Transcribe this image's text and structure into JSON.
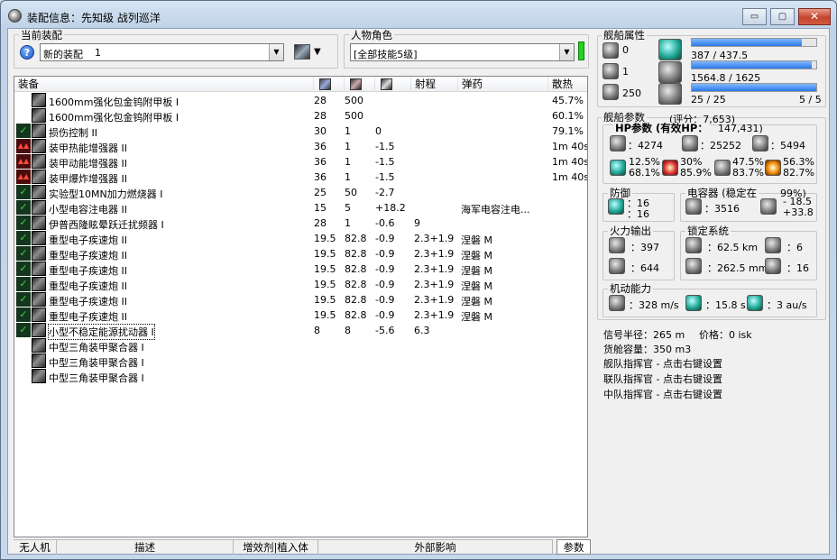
{
  "window": {
    "title": "装配信息：先知级 战列巡洋",
    "controls": {
      "minimize": "▭",
      "maximize": "▢",
      "close": "✕"
    }
  },
  "fitting": {
    "current_label": "当前装配",
    "fit_name": "新的装配",
    "fit_count": "1"
  },
  "character": {
    "label": "人物角色",
    "value": "[全部技能5级]"
  },
  "columns": {
    "equipment": "装备",
    "range": "射程",
    "ammo": "弹药",
    "dispersion": "散热",
    "icon_names": [
      "capacitor-icon",
      "cpu-icon",
      "powergrid-icon"
    ]
  },
  "modules": [
    {
      "status": "none",
      "name": "1600mm强化包金钨附甲板 I",
      "cpu": "28",
      "pg": "500",
      "cap": "",
      "range": "",
      "ammo": "",
      "heat": "45.7%"
    },
    {
      "status": "none",
      "name": "1600mm强化包金钨附甲板 I",
      "cpu": "28",
      "pg": "500",
      "cap": "",
      "range": "",
      "ammo": "",
      "heat": "60.1%"
    },
    {
      "status": "on",
      "name": "损伤控制 II",
      "cpu": "30",
      "pg": "1",
      "cap": "0",
      "range": "",
      "ammo": "",
      "heat": "79.1%"
    },
    {
      "status": "heat",
      "name": "装甲热能增强器 II",
      "cpu": "36",
      "pg": "1",
      "cap": "-1.5",
      "range": "",
      "ammo": "",
      "heat": "1m 40s"
    },
    {
      "status": "heat",
      "name": "装甲动能增强器 II",
      "cpu": "36",
      "pg": "1",
      "cap": "-1.5",
      "range": "",
      "ammo": "",
      "heat": "1m 40s"
    },
    {
      "status": "heat",
      "name": "装甲爆炸增强器 II",
      "cpu": "36",
      "pg": "1",
      "cap": "-1.5",
      "range": "",
      "ammo": "",
      "heat": "1m 40s"
    },
    {
      "status": "on",
      "name": "实验型10MN加力燃烧器 I",
      "cpu": "25",
      "pg": "50",
      "cap": "-2.7",
      "range": "",
      "ammo": "",
      "heat": ""
    },
    {
      "status": "on",
      "name": "小型电容注电器 II",
      "cpu": "15",
      "pg": "5",
      "cap": "+18.2",
      "range": "",
      "ammo": "海军电容注电...",
      "heat": ""
    },
    {
      "status": "on",
      "name": "伊普西隆眩晕跃迁扰频器 I",
      "cpu": "28",
      "pg": "1",
      "cap": "-0.6",
      "range": "9",
      "ammo": "",
      "heat": ""
    },
    {
      "status": "on",
      "name": "重型电子疾速炮 II",
      "cpu": "19.5",
      "pg": "82.8",
      "cap": "-0.9",
      "range": "2.3+1.9",
      "ammo": "涅磐 M",
      "heat": ""
    },
    {
      "status": "on",
      "name": "重型电子疾速炮 II",
      "cpu": "19.5",
      "pg": "82.8",
      "cap": "-0.9",
      "range": "2.3+1.9",
      "ammo": "涅磐 M",
      "heat": ""
    },
    {
      "status": "on",
      "name": "重型电子疾速炮 II",
      "cpu": "19.5",
      "pg": "82.8",
      "cap": "-0.9",
      "range": "2.3+1.9",
      "ammo": "涅磐 M",
      "heat": ""
    },
    {
      "status": "on",
      "name": "重型电子疾速炮 II",
      "cpu": "19.5",
      "pg": "82.8",
      "cap": "-0.9",
      "range": "2.3+1.9",
      "ammo": "涅磐 M",
      "heat": ""
    },
    {
      "status": "on",
      "name": "重型电子疾速炮 II",
      "cpu": "19.5",
      "pg": "82.8",
      "cap": "-0.9",
      "range": "2.3+1.9",
      "ammo": "涅磐 M",
      "heat": ""
    },
    {
      "status": "on",
      "name": "重型电子疾速炮 II",
      "cpu": "19.5",
      "pg": "82.8",
      "cap": "-0.9",
      "range": "2.3+1.9",
      "ammo": "涅磐 M",
      "heat": ""
    },
    {
      "status": "on",
      "name": "小型不稳定能源扰动器 I",
      "cpu": "8",
      "pg": "8",
      "cap": "-5.6",
      "range": "6.3",
      "ammo": "",
      "heat": ""
    },
    {
      "status": "none",
      "name": "中型三角装甲聚合器 I",
      "cpu": "",
      "pg": "",
      "cap": "",
      "range": "",
      "ammo": "",
      "heat": ""
    },
    {
      "status": "none",
      "name": "中型三角装甲聚合器 I",
      "cpu": "",
      "pg": "",
      "cap": "",
      "range": "",
      "ammo": "",
      "heat": ""
    },
    {
      "status": "none",
      "name": "中型三角装甲聚合器 I",
      "cpu": "",
      "pg": "",
      "cap": "",
      "range": "",
      "ammo": "",
      "heat": ""
    }
  ],
  "bottom_tabs": [
    "无人机",
    "描述",
    "增效剂|植入体",
    "外部影响",
    "参数"
  ],
  "ship_attributes": {
    "label": "舰船属性",
    "slots": [
      "0",
      "1",
      "250"
    ],
    "cpu_text": "387 / 437.5",
    "cpu_fraction": 0.885,
    "pg_text": "1564.8 / 1625",
    "pg_fraction": 0.963,
    "calib_left": "25 / 25",
    "calib_right": "5 / 5",
    "calib_fraction": 1.0
  },
  "params": {
    "label": "舰船参数",
    "score": "(评分：7,653)",
    "hp_title": "HP参数 (有效HP：",
    "hp_value": "147,431)",
    "hp_shield": "：4274",
    "hp_armor": "：25252",
    "hp_hull": "：5494",
    "resist": [
      [
        "12.5%",
        "68.1%"
      ],
      [
        "30%",
        "85.9%"
      ],
      [
        "47.5%",
        "83.7%"
      ],
      [
        "56.3%",
        "82.7%"
      ]
    ]
  },
  "defense": {
    "label": "防御",
    "v1": "：16",
    "v2": "：16"
  },
  "capacitor": {
    "label": "电容器 (稳定在",
    "pct": "99%)",
    "amount": "：3516",
    "delta1": "- 18.5",
    "delta2": "+33.8"
  },
  "firepower": {
    "label": "火力输出",
    "v1": "：397",
    "v2": "：644"
  },
  "targeting": {
    "label": "锁定系统",
    "range": "：62.5 km",
    "targets": "：6",
    "scan": "：262.5 mm",
    "sig": "：16"
  },
  "mobility": {
    "label": "机动能力",
    "speed": "：328 m/s",
    "align": "：15.8 s",
    "warp": "：3 au/s"
  },
  "misc": {
    "sig_radius": "信号半径：265 m",
    "price": "价格：0 isk",
    "cargo": "货舱容量：350 m3",
    "fleet_cmd": "舰队指挥官 - 点击右键设置",
    "wing_cmd": "联队指挥官 - 点击右键设置",
    "squad_cmd": "中队指挥官 - 点击右键设置"
  }
}
